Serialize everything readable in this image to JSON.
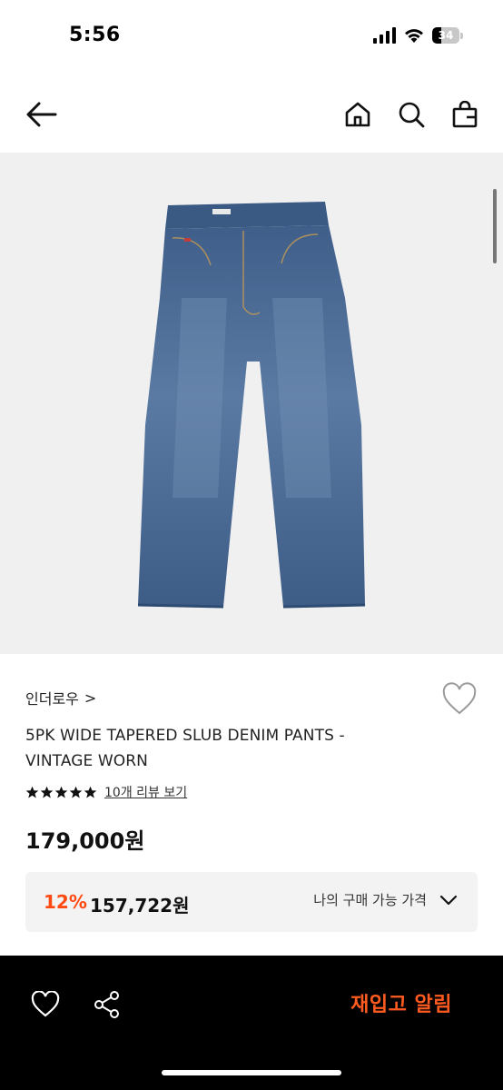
{
  "status_bar": {
    "time": "5:56",
    "battery": "34",
    "battery_level": 0.34
  },
  "nav": {
    "back_icon": "arrow-left-icon",
    "home_icon": "home-icon",
    "search_icon": "search-icon",
    "cart_icon": "shopping-bag-icon"
  },
  "product": {
    "image_icon": "denim-jeans-image",
    "brand": "인더로우",
    "brand_chevron": ">",
    "name": "5PK WIDE TAPERED SLUB DENIM PANTS - VINTAGE WORN",
    "rating_stars": 5,
    "review_link": "10개 리뷰 보기",
    "price": "179,000원",
    "discount": {
      "rate": "12%",
      "price": "157,722원",
      "label": "나의 구매 가능 가격"
    }
  },
  "bottom_bar": {
    "wishlist_icon": "heart-icon",
    "share_icon": "share-icon",
    "restock_label": "재입고 알림"
  },
  "colors": {
    "accent": "#ff4a12",
    "restock": "#ff5a1f",
    "bottom_bg": "#000000"
  }
}
